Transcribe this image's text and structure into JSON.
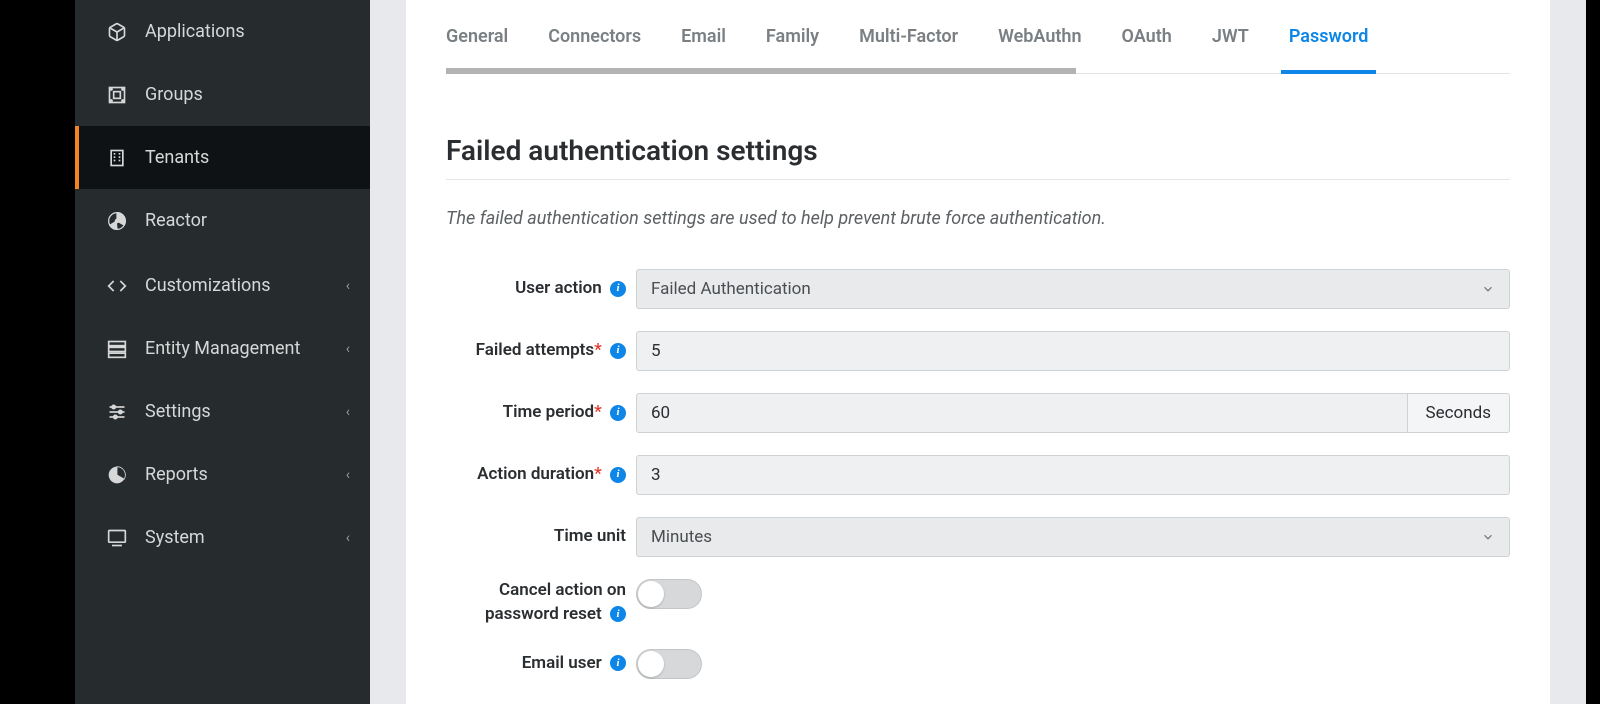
{
  "sidebar": {
    "items": [
      {
        "label": "Applications",
        "icon": "cube"
      },
      {
        "label": "Groups",
        "icon": "groups"
      },
      {
        "label": "Tenants",
        "icon": "building",
        "active": true
      },
      {
        "label": "Reactor",
        "icon": "radiation"
      },
      {
        "label": "Customizations",
        "icon": "code",
        "expandable": true
      },
      {
        "label": "Entity Management",
        "icon": "server",
        "expandable": true
      },
      {
        "label": "Settings",
        "icon": "sliders",
        "expandable": true
      },
      {
        "label": "Reports",
        "icon": "piechart",
        "expandable": true
      },
      {
        "label": "System",
        "icon": "monitor",
        "expandable": true
      }
    ]
  },
  "tabs": [
    {
      "label": "General"
    },
    {
      "label": "Connectors"
    },
    {
      "label": "Email"
    },
    {
      "label": "Family"
    },
    {
      "label": "Multi-Factor"
    },
    {
      "label": "WebAuthn"
    },
    {
      "label": "OAuth"
    },
    {
      "label": "JWT"
    },
    {
      "label": "Password",
      "active": true
    }
  ],
  "section": {
    "title": "Failed authentication settings",
    "description": "The failed authentication settings are used to help prevent brute force authentication."
  },
  "form": {
    "user_action": {
      "label": "User action",
      "value": "Failed Authentication"
    },
    "failed_attempts": {
      "label": "Failed attempts",
      "value": "5"
    },
    "time_period": {
      "label": "Time period",
      "value": "60",
      "unit": "Seconds"
    },
    "action_duration": {
      "label": "Action duration",
      "value": "3"
    },
    "time_unit": {
      "label": "Time unit",
      "value": "Minutes"
    },
    "cancel_on_reset": {
      "label": "Cancel action on password reset",
      "value": false
    },
    "email_user": {
      "label": "Email user",
      "value": false
    }
  }
}
